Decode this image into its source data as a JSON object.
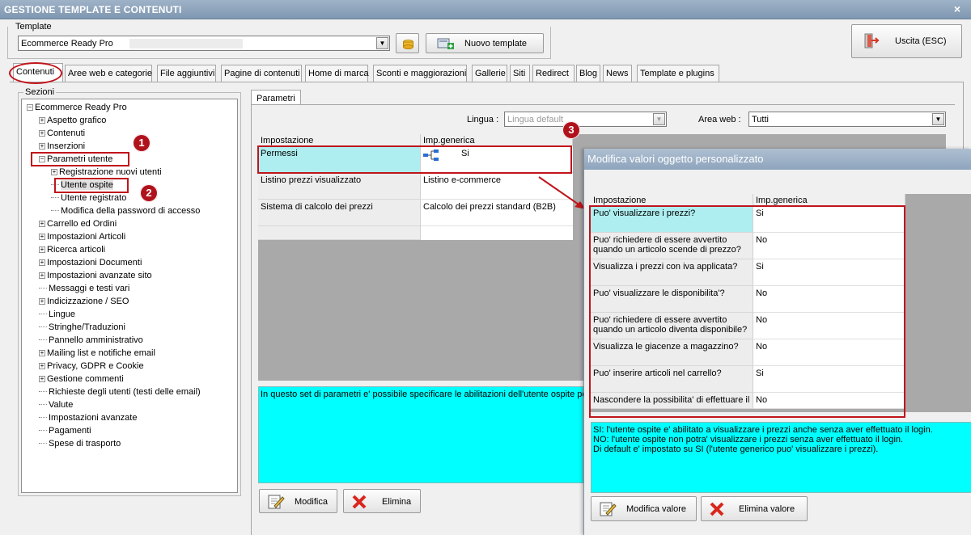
{
  "window": {
    "title": "GESTIONE TEMPLATE E CONTENUTI",
    "close_label": "×"
  },
  "template": {
    "label": "Template",
    "selected": "Ecommerce Ready Pro",
    "new_button": "Nuovo template",
    "exit_button": "Uscita (ESC)"
  },
  "tabs": [
    "Contenuti",
    "Aree web e categorie",
    "File aggiuntivi",
    "Pagine di contenuti",
    "Home di marca",
    "Sconti e maggiorazioni",
    "Gallerie",
    "Siti",
    "Redirect",
    "Blog",
    "News",
    "Template e plugins"
  ],
  "sections": {
    "label": "Sezioni",
    "root": "Ecommerce Ready Pro",
    "items": [
      {
        "label": "Aspetto grafico",
        "exp": "+"
      },
      {
        "label": "Contenuti",
        "exp": "+"
      },
      {
        "label": "Inserzioni",
        "exp": "+"
      },
      {
        "label": "Parametri utente",
        "exp": "−"
      },
      {
        "label": "Registrazione nuovi utenti",
        "exp": "+",
        "child": true
      },
      {
        "label": "Utente ospite",
        "exp": "",
        "child": true
      },
      {
        "label": "Utente registrato",
        "exp": "",
        "child": true
      },
      {
        "label": "Modifica della password di accesso",
        "exp": "",
        "child": true
      },
      {
        "label": "Carrello ed Ordini",
        "exp": "+"
      },
      {
        "label": "Impostazioni Articoli",
        "exp": "+"
      },
      {
        "label": "Ricerca articoli",
        "exp": "+"
      },
      {
        "label": "Impostazioni Documenti",
        "exp": "+"
      },
      {
        "label": "Impostazioni avanzate sito",
        "exp": "+"
      },
      {
        "label": "Messaggi e testi vari",
        "exp": ""
      },
      {
        "label": "Indicizzazione / SEO",
        "exp": "+"
      },
      {
        "label": "Lingue",
        "exp": ""
      },
      {
        "label": "Stringhe/Traduzioni",
        "exp": ""
      },
      {
        "label": "Pannello amministrativo",
        "exp": ""
      },
      {
        "label": "Mailing list e notifiche email",
        "exp": "+"
      },
      {
        "label": "Privacy, GDPR e Cookie",
        "exp": "+"
      },
      {
        "label": "Gestione commenti",
        "exp": "+"
      },
      {
        "label": "Richieste degli utenti (testi delle email)",
        "exp": ""
      },
      {
        "label": "Valute",
        "exp": ""
      },
      {
        "label": "Impostazioni avanzate",
        "exp": ""
      },
      {
        "label": "Pagamenti",
        "exp": ""
      },
      {
        "label": "Spese di trasporto",
        "exp": ""
      }
    ]
  },
  "params": {
    "tab": "Parametri",
    "lingua_label": "Lingua :",
    "lingua_value": "Lingua default",
    "area_label": "Area web :",
    "area_value": "Tutti",
    "col1": "Impostazione",
    "col2": "Imp.generica",
    "rows": [
      {
        "name": "Permessi",
        "value": "Si"
      },
      {
        "name": "Listino prezzi visualizzato",
        "value": "Listino e-commerce"
      },
      {
        "name": "Sistema di calcolo dei prezzi",
        "value": "Calcolo dei prezzi standard (B2B)"
      }
    ],
    "info": "In questo set di parametri e' possibile specificare le abilitazioni dell'utente ospite per",
    "edit_button": "Modifica",
    "delete_button": "Elimina"
  },
  "dialog": {
    "title": "Modifica valori oggetto personalizzato",
    "col1": "Impostazione",
    "col2": "Imp.generica",
    "rows": [
      {
        "name": "Puo' visualizzare i prezzi?",
        "value": "Si"
      },
      {
        "name": "Puo' richiedere di essere avvertito quando un articolo scende di prezzo?",
        "value": "No"
      },
      {
        "name": "Visualizza i prezzi con iva applicata?",
        "value": "Si"
      },
      {
        "name": "Puo' visualizzare le disponibilita'?",
        "value": "No"
      },
      {
        "name": "Puo' richiedere di essere avvertito quando un articolo diventa disponibile?",
        "value": "No"
      },
      {
        "name": "Visualizza le giacenze a magazzino?",
        "value": "No"
      },
      {
        "name": "Puo' inserire articoli nel carrello?",
        "value": "Si"
      },
      {
        "name": "Nascondere la possibilita' di effettuare il login?",
        "value": "No"
      }
    ],
    "info_lines": [
      "SI: l'utente ospite e' abilitato a visualizzare i prezzi anche senza aver effettuato il login.",
      "NO: l'utente ospite non potra' visualizzare i prezzi senza aver effettuato il login.",
      "Di default e' impostato su SI (l'utente generico puo' visualizzare i prezzi)."
    ],
    "edit_button": "Modifica valore",
    "delete_button": "Elimina valore"
  },
  "callouts": [
    "1",
    "2",
    "3"
  ],
  "colors": {
    "highlight_red": "#c0151b",
    "info_cyan": "#00ffff",
    "selected_cyan": "#aeeef0",
    "titlebar": "#8ea5bd"
  }
}
